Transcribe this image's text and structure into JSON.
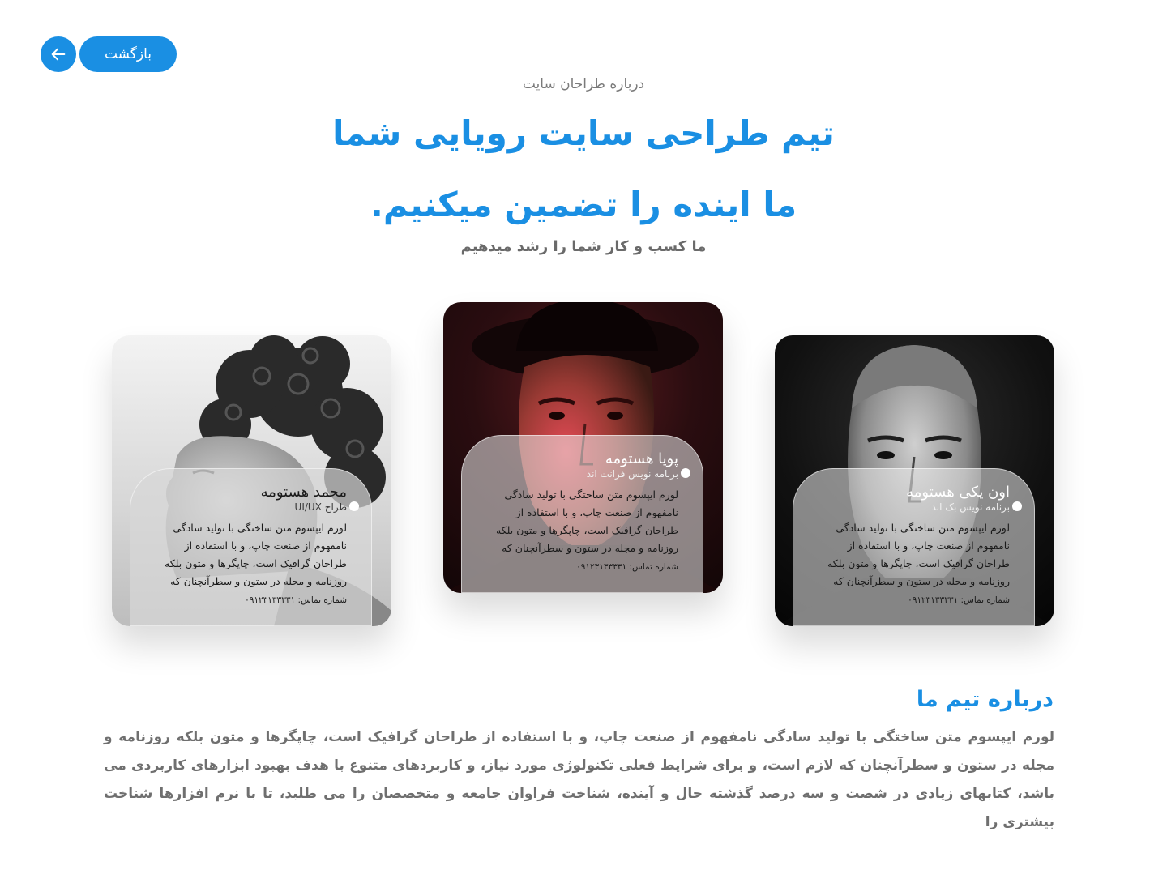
{
  "colors": {
    "accent": "#1a8fe3",
    "text_muted": "#6f6f6f"
  },
  "back_button": {
    "label": "بازگشت",
    "icon": "arrow-left-icon"
  },
  "header": {
    "eyebrow": "درباره طراحان سایت",
    "headline_line1": "تیم طراحی سایت رویایی شما",
    "headline_line2": "ما اینده را تضمین میکنیم.",
    "subline": "ما کسب و کار شما را رشد میدهیم"
  },
  "team": [
    {
      "name": "محمد هستومه",
      "role": "طراح UI/UX",
      "bio": "لورم ایپسوم متن ساختگی با تولید سادگی نامفهوم از صنعت چاپ، و با استفاده از طراحان گرافیک است، چاپگرها و متون بلکه روزنامه و مجله در ستون و سطرآنچنان که",
      "phone": "شماره تماس: ۰۹۱۲۳۱۳۳۳۳۱"
    },
    {
      "name": "پویا هستومه",
      "role": "برنامه نویس فرانت اند",
      "bio": "لورم ایپسوم متن ساختگی با تولید سادگی نامفهوم از صنعت چاپ، و با استفاده از طراحان گرافیک است، چاپگرها و متون بلکه روزنامه و مجله در ستون و سطرآنچنان که",
      "phone": "شماره تماس: ۰۹۱۲۳۱۳۳۳۳۱"
    },
    {
      "name": "اون یکی هستومه",
      "role": "برنامه نویس بک اند",
      "bio": "لورم ایپسوم متن ساختگی با تولید سادگی نامفهوم از صنعت چاپ، و با استفاده از طراحان گرافیک است، چاپگرها و متون بلکه روزنامه و مجله در ستون و سطرآنچنان که",
      "phone": "شماره تماس: ۰۹۱۲۳۱۳۳۳۳۱"
    }
  ],
  "about": {
    "title": "درباره تیم ما",
    "text": "لورم ایپسوم متن ساختگی با تولید سادگی نامفهوم از صنعت چاپ، و با استفاده از طراحان گرافیک است، چاپگرها و متون بلکه روزنامه و مجله در ستون و سطرآنچنان که لازم است، و برای شرایط فعلی تکنولوژی مورد نیاز، و کاربردهای متنوع با هدف بهبود ابزارهای کاربردی می باشد، کتابهای زیادی در شصت و سه درصد گذشته حال و آینده، شناخت فراوان جامعه و متخصصان را می طلبد، تا با نرم افزارها شناخت بیشتری را"
  }
}
